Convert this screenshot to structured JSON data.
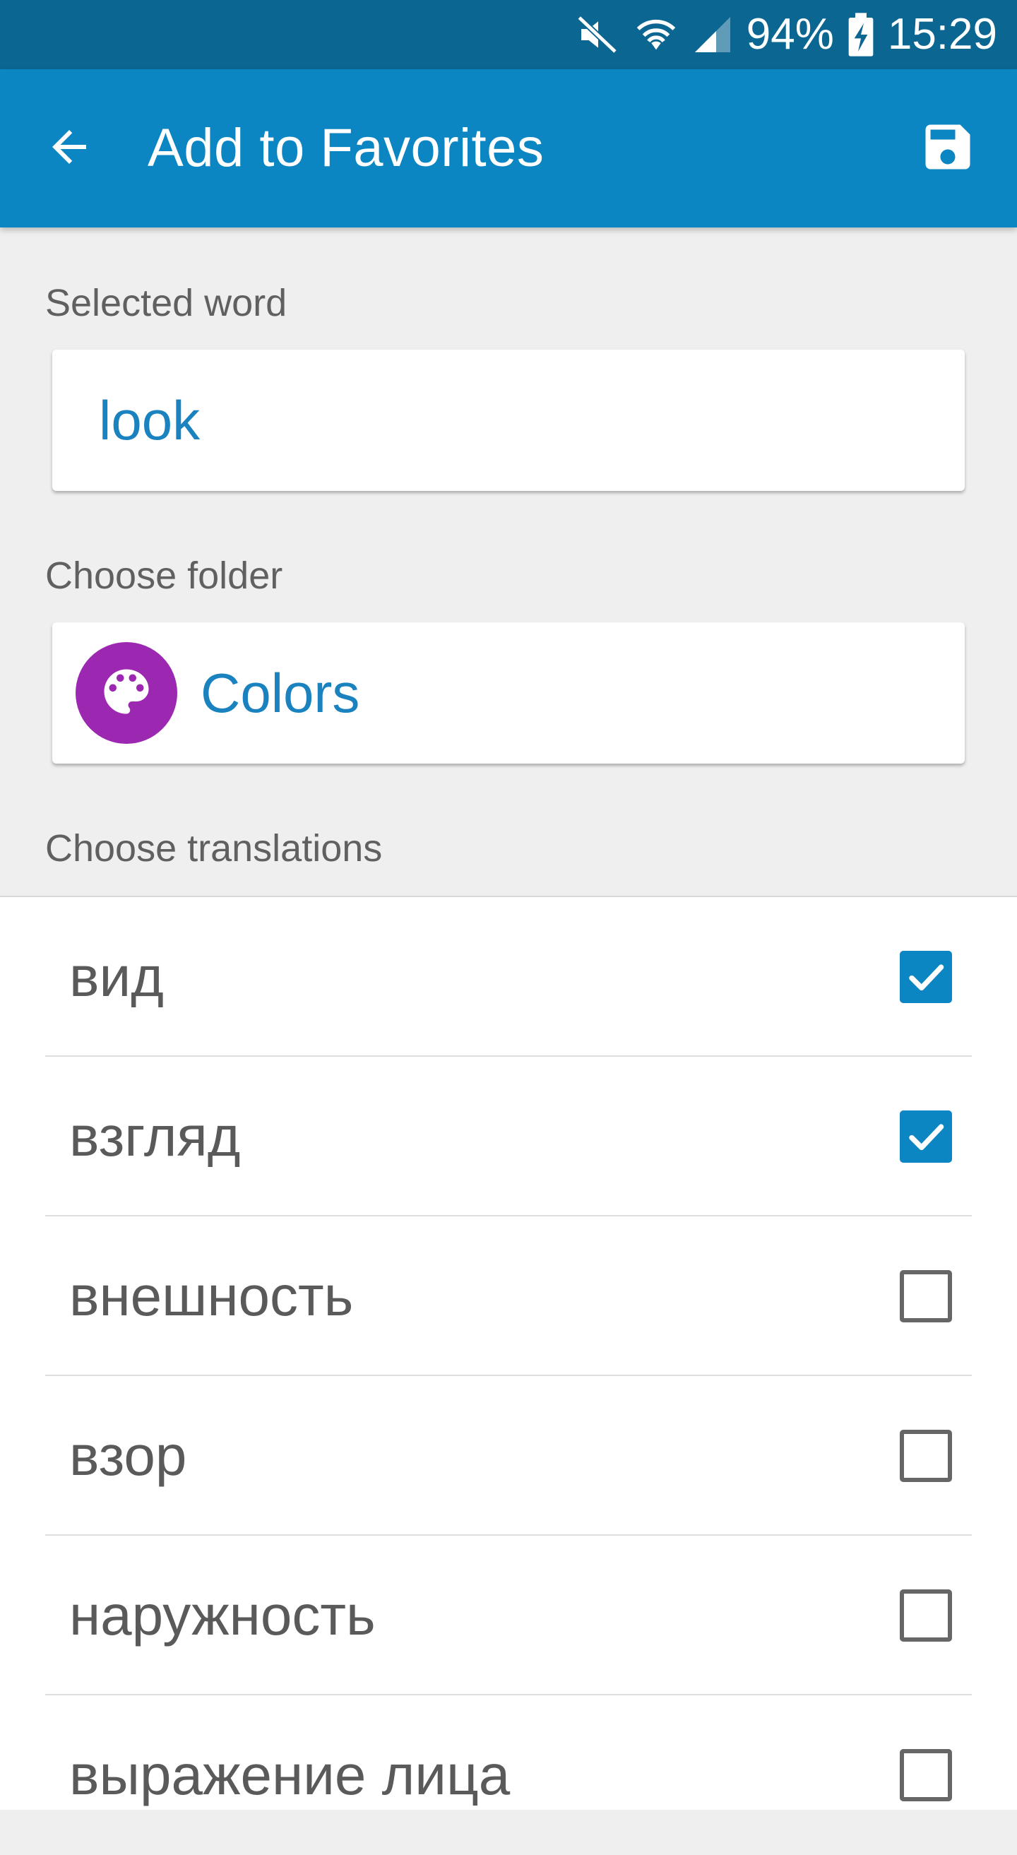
{
  "status_bar": {
    "battery_percent": "94%",
    "time": "15:29",
    "icons": [
      "mute-icon",
      "wifi-icon",
      "signal-icon",
      "battery-charging-icon"
    ]
  },
  "app_bar": {
    "title": "Add to Favorites",
    "back_icon": "arrow-back-icon",
    "save_icon": "save-icon"
  },
  "selected_word": {
    "label": "Selected word",
    "value": "look"
  },
  "folder": {
    "label": "Choose folder",
    "name": "Colors",
    "icon": "palette-icon",
    "color": "#9c27b0"
  },
  "translations": {
    "label": "Choose translations",
    "items": [
      {
        "text": "вид",
        "checked": true
      },
      {
        "text": "взгляд",
        "checked": true
      },
      {
        "text": "внешность",
        "checked": false
      },
      {
        "text": "взор",
        "checked": false
      },
      {
        "text": "наружность",
        "checked": false
      },
      {
        "text": "выражение лица",
        "checked": false
      }
    ]
  },
  "colors": {
    "status_bar": "#0b6791",
    "app_bar": "#0c86c2",
    "accent": "#1a82bf"
  }
}
